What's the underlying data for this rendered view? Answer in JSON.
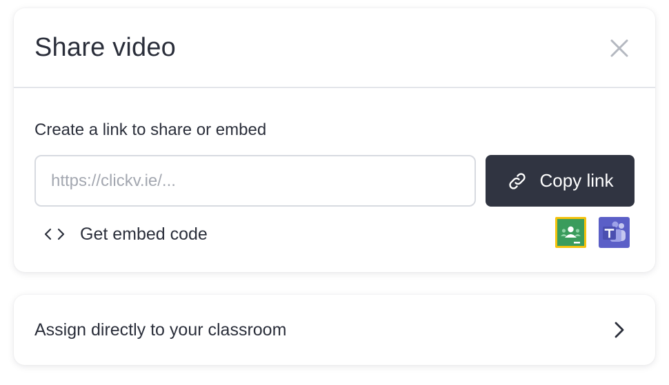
{
  "dialog": {
    "title": "Share video",
    "close_icon": "close-icon"
  },
  "link_section": {
    "label": "Create a link to share or embed",
    "input_value": "",
    "input_placeholder": "https://clickv.ie/...",
    "copy_button_label": "Copy link",
    "copy_button_icon": "link-icon",
    "embed_label": "Get embed code",
    "embed_icon": "code-icon"
  },
  "integrations": [
    {
      "name": "Google Classroom",
      "icon": "google-classroom-icon"
    },
    {
      "name": "Microsoft Teams",
      "icon": "microsoft-teams-icon"
    }
  ],
  "assign": {
    "label": "Assign directly to your classroom",
    "icon": "chevron-right-icon"
  },
  "colors": {
    "primary_button": "#303441",
    "text": "#2a2e3a",
    "placeholder": "#a3a7b0",
    "border": "#d7dae0",
    "divider": "#e3e5ea",
    "classroom_green": "#3a9c5c",
    "classroom_yellow": "#f4c20d",
    "teams_purple": "#5b5fc7"
  }
}
